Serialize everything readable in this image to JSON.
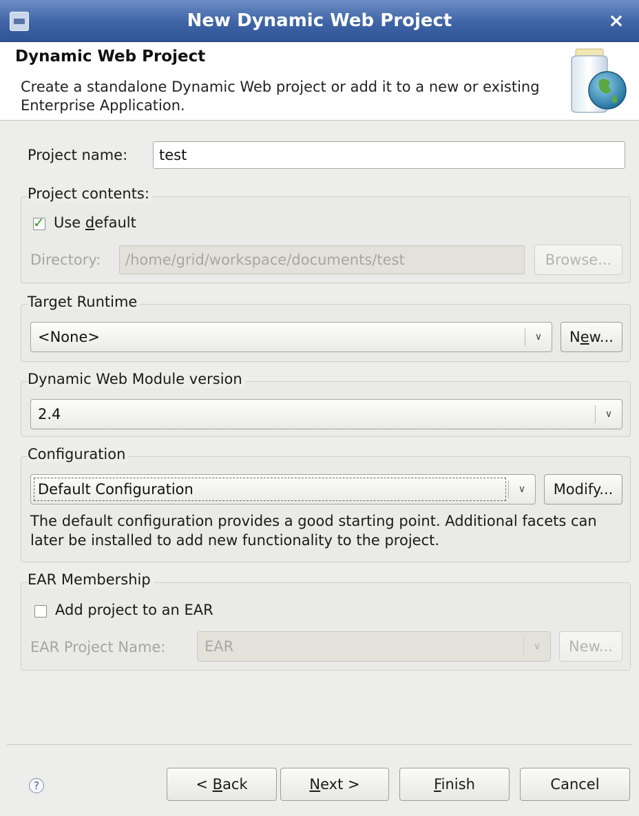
{
  "window": {
    "title": "New Dynamic Web Project"
  },
  "banner": {
    "title": "Dynamic Web Project",
    "description": "Create a standalone Dynamic Web project or add it to a new or existing Enterprise Application."
  },
  "project_name": {
    "label": "Project name:",
    "value": "test"
  },
  "project_contents": {
    "group_title": "Project contents:",
    "use_default_label_pre": "Use ",
    "use_default_label_mnemonic": "d",
    "use_default_label_post": "efault",
    "use_default_checked": true,
    "directory_label": "Directory:",
    "directory_value": "/home/grid/workspace/documents/test",
    "browse_label": "Browse..."
  },
  "target_runtime": {
    "group_title": "Target Runtime",
    "selected": "<None>",
    "new_pre": "N",
    "new_mnemonic": "e",
    "new_post": "w..."
  },
  "web_module": {
    "group_title": "Dynamic Web Module version",
    "selected": "2.4"
  },
  "configuration": {
    "group_title": "Configuration",
    "selected": "Default Configuration",
    "modify_label": "Modify...",
    "description": "The default configuration provides a good starting point. Additional facets can later be installed to add new functionality to the project."
  },
  "ear": {
    "group_title": "EAR Membership",
    "add_label": "Add project to an EAR",
    "add_checked": false,
    "project_name_label": "EAR Project Name:",
    "project_name_value": "EAR",
    "new_label": "New..."
  },
  "buttons": {
    "back_pre": "< ",
    "back_mnemonic": "B",
    "back_post": "ack",
    "next_mnemonic": "N",
    "next_post": "ext >",
    "finish_mnemonic": "F",
    "finish_post": "inish",
    "cancel": "Cancel"
  },
  "icons": {
    "help": "?",
    "close": "×",
    "check": "✓",
    "dropdown": "∨"
  }
}
